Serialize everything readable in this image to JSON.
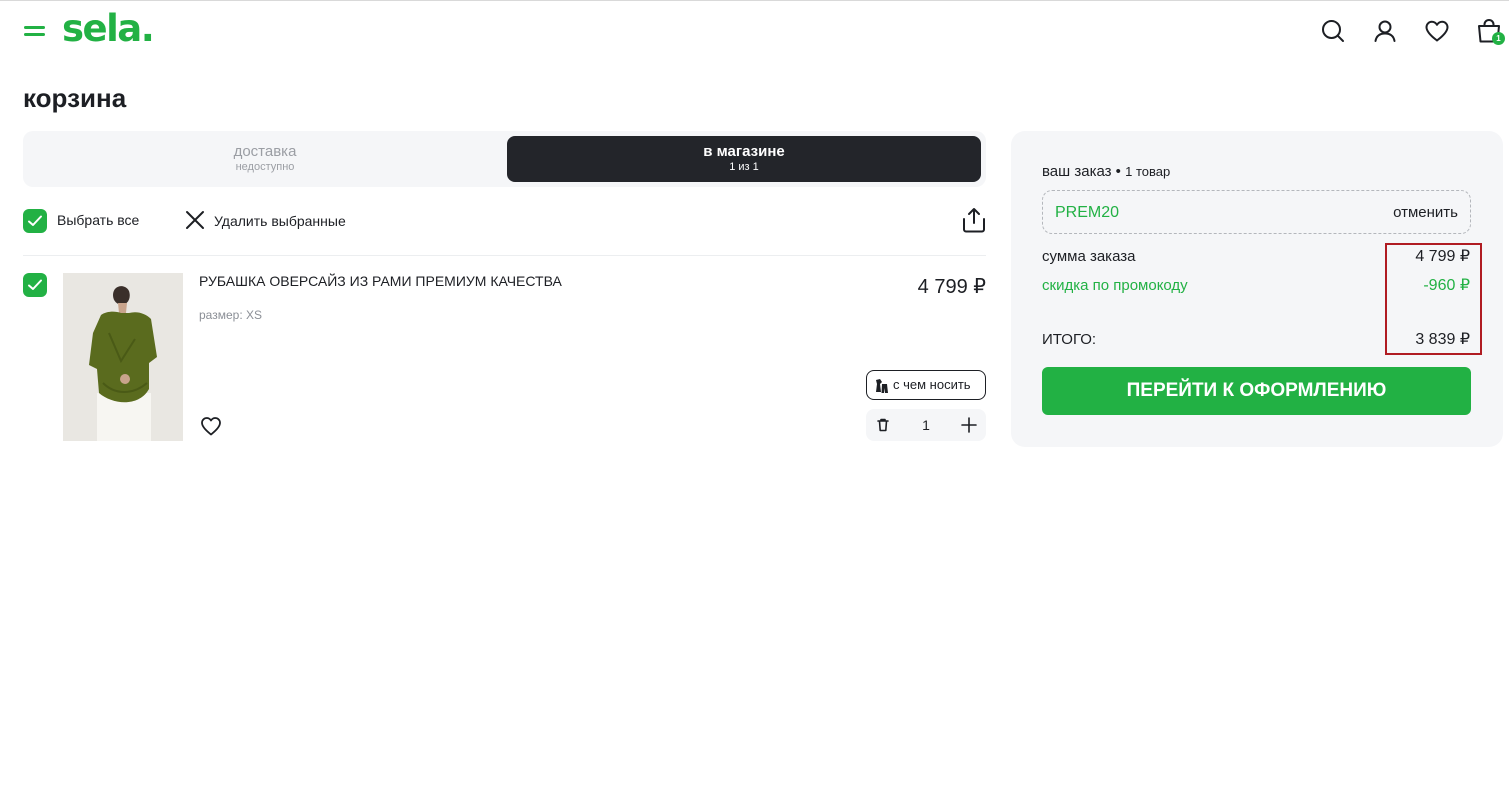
{
  "header": {
    "logo": "sela.",
    "cart_count": "1",
    "icons": [
      "menu-icon",
      "search-icon",
      "user-icon",
      "heart-icon",
      "bag-icon"
    ]
  },
  "page": {
    "title": "корзина"
  },
  "tabs": [
    {
      "label": "доставка",
      "sub": "недоступно",
      "active": false
    },
    {
      "label": "в магазине",
      "sub": "1 из 1",
      "active": true
    }
  ],
  "actions": {
    "select_all": "Выбрать все",
    "delete_selected": "Удалить выбранные"
  },
  "product": {
    "name": "РУБАШКА ОВЕРСАЙЗ ИЗ РАМИ ПРЕМИУМ КАЧЕСТВА",
    "size": "размер: XS",
    "price": "4 799 ₽",
    "wear_with": "с чем носить",
    "quantity": "1"
  },
  "summary": {
    "title": "ваш заказ",
    "count": "1 товар",
    "promo_code": "PREM20",
    "promo_cancel": "отменить",
    "order_sum_label": "сумма заказа",
    "order_sum": "4 799 ₽",
    "discount_label": "скидка по промокоду",
    "discount": "-960 ₽",
    "total_label": "ИТОГО:",
    "total": "3 839 ₽",
    "checkout": "ПЕРЕЙТИ К ОФОРМЛЕНИЮ"
  },
  "colors": {
    "brand": "#22b144",
    "dark": "#23252a",
    "highlight": "#b01c22"
  }
}
